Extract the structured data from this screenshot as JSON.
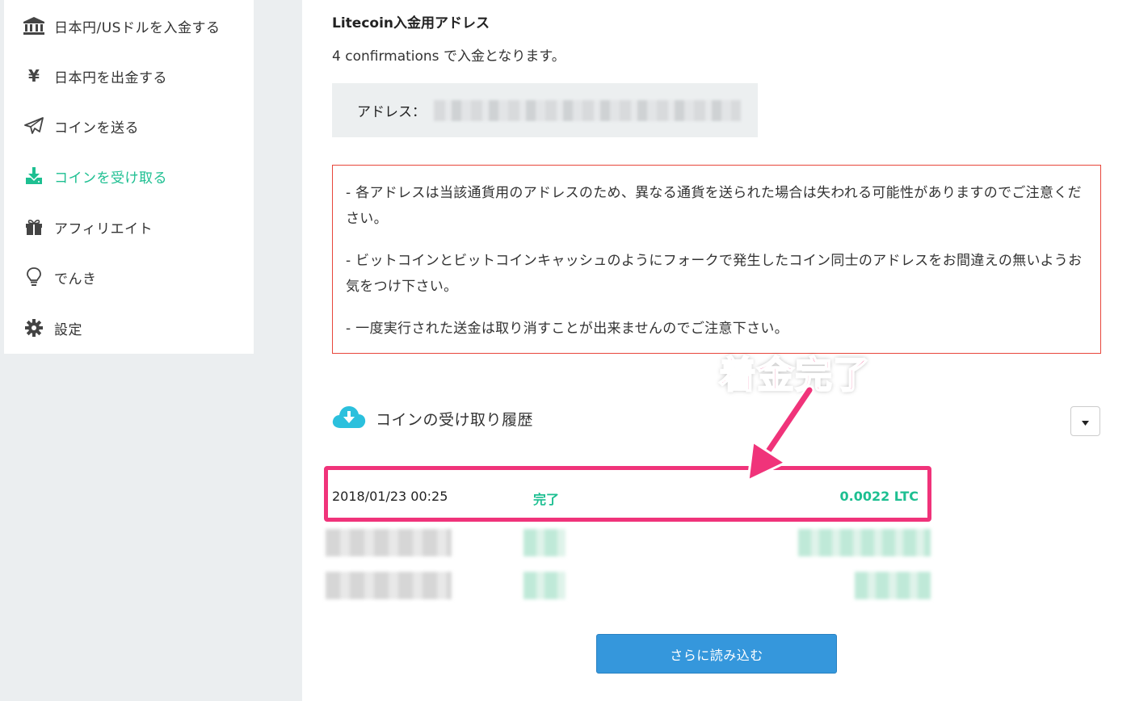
{
  "sidebar": {
    "items": [
      {
        "label": "日本円/USドルを入金する",
        "icon": "bank-icon"
      },
      {
        "label": "日本円を出金する",
        "icon": "yen-icon"
      },
      {
        "label": "コインを送る",
        "icon": "paper-plane-icon"
      },
      {
        "label": "コインを受け取る",
        "icon": "download-icon",
        "active": true
      },
      {
        "label": "アフィリエイト",
        "icon": "gift-icon"
      },
      {
        "label": "でんき",
        "icon": "lightbulb-icon"
      },
      {
        "label": "設定",
        "icon": "gear-icon"
      }
    ]
  },
  "deposit": {
    "title": "Litecoin入金用アドレス",
    "confirmations": "4 confirmations で入金となります。",
    "address_label": "アドレス："
  },
  "warnings": [
    "- 各アドレスは当該通貨用のアドレスのため、異なる通貨を送られた場合は失われる可能性がありますのでご注意ください。",
    "- ビットコインとビットコインキャッシュのようにフォークで発生したコイン同士のアドレスをお間違えの無いようお気をつけ下さい。",
    "- 一度実行された送金は取り消すことが出来ませんのでご注意下さい。"
  ],
  "annotation": "着金完了",
  "history": {
    "title": "コインの受け取り履歴",
    "rows": [
      {
        "date": "2018/01/23 00:25",
        "status": "完了",
        "amount": "0.0022 LTC"
      }
    ],
    "load_more": "さらに読み込む"
  },
  "colors": {
    "accent_green": "#1dbf91",
    "highlight_pink": "#f0337a",
    "warning_red": "#e8463b",
    "button_blue": "#3597dc"
  }
}
